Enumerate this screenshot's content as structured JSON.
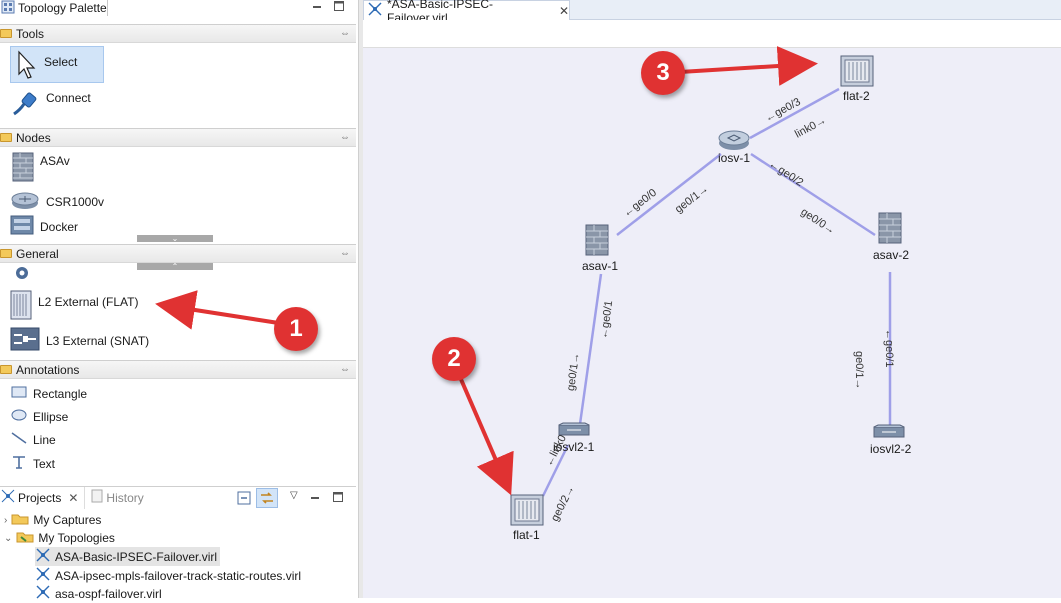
{
  "palette": {
    "title": "Topology Palette",
    "tools": {
      "header": "Tools",
      "items": [
        {
          "label": "Select",
          "icon": "arrow-cursor-icon"
        },
        {
          "label": "Connect",
          "icon": "cable-plug-icon"
        }
      ]
    },
    "nodes": {
      "header": "Nodes",
      "items": [
        {
          "label": "ASAv",
          "icon": "firewall-icon"
        },
        {
          "label": "CSR1000v",
          "icon": "router-icon"
        },
        {
          "label": "Docker",
          "icon": "server-icon"
        }
      ]
    },
    "general": {
      "header": "General",
      "items": [
        {
          "label": "",
          "icon": "gear-icon"
        },
        {
          "label": "L2 External (FLAT)",
          "icon": "flat-network-icon"
        },
        {
          "label": "L3 External (SNAT)",
          "icon": "snat-icon"
        }
      ]
    },
    "annotations": {
      "header": "Annotations",
      "items": [
        {
          "label": "Rectangle",
          "icon": "rectangle-icon"
        },
        {
          "label": "Ellipse",
          "icon": "ellipse-icon"
        },
        {
          "label": "Line",
          "icon": "line-icon"
        },
        {
          "label": "Text",
          "icon": "text-icon"
        }
      ]
    }
  },
  "projects": {
    "tab_label": "Projects",
    "history_label": "History",
    "tree": [
      {
        "label": "My Captures",
        "expanded": false
      },
      {
        "label": "My Topologies",
        "expanded": true
      },
      {
        "label": "ASA-Basic-IPSEC-Failover.virl",
        "selected": true
      },
      {
        "label": "ASA-ipsec-mpls-failover-track-static-routes.virl"
      },
      {
        "label": "asa-ospf-failover.virl"
      }
    ]
  },
  "editor": {
    "tab_label": "*ASA-Basic-IPSEC-Failover.virl"
  },
  "topology": {
    "nodes": {
      "flat2": "flat-2",
      "iosv1": "iosv-1",
      "asav1": "asav-1",
      "asav2": "asav-2",
      "iosvl2_1": "iosvl2-1",
      "iosvl2_2": "iosvl2-2",
      "flat1": "flat-1"
    },
    "links": {
      "l1": "←ge0/3",
      "l2": "link0→",
      "l3": "←ge0/2",
      "l4": "←ge0/0",
      "l5": "ge0/1→",
      "l6": "ge0/0→",
      "l7": "←ge0/1",
      "l8": "ge0/1→",
      "l9": "←ge0/1",
      "l10": "ge0/1→",
      "l11": "←link0",
      "l12": "ge0/2→"
    },
    "link_color": "#9f9fe8"
  },
  "callouts": [
    "1",
    "2",
    "3"
  ],
  "colors": {
    "callout": "#e03232",
    "arrow": "#e03232",
    "selection": "#d2e4f8"
  }
}
